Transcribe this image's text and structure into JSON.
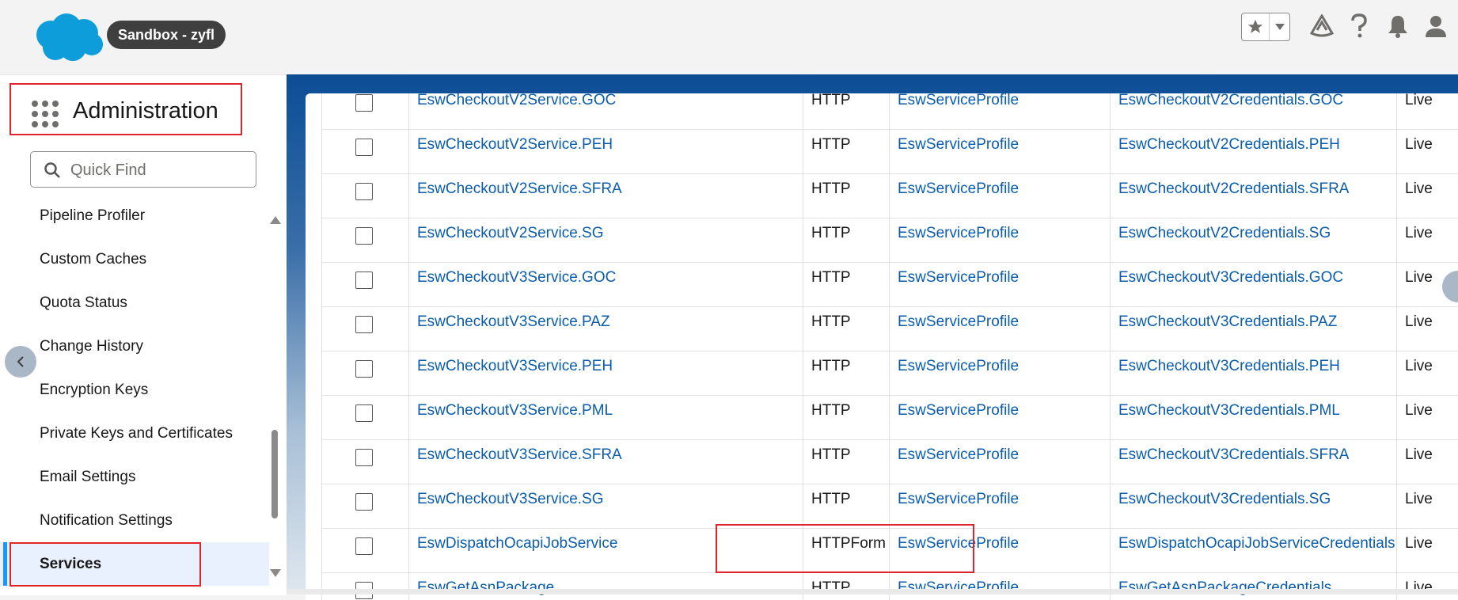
{
  "header": {
    "sandbox_badge": "Sandbox - zyfl",
    "icons": [
      "salesforce-cloud-logo",
      "star-icon",
      "chevron-down-icon",
      "trailhead-icon",
      "help-icon",
      "bell-icon",
      "user-avatar-icon"
    ]
  },
  "sidebar": {
    "app_title": "Administration",
    "quick_find_placeholder": "Quick Find",
    "items": [
      {
        "label": "Pipeline Profiler"
      },
      {
        "label": "Custom Caches"
      },
      {
        "label": "Quota Status"
      },
      {
        "label": "Change History"
      },
      {
        "label": "Encryption Keys"
      },
      {
        "label": "Private Keys and Certificates"
      },
      {
        "label": "Email Settings"
      },
      {
        "label": "Notification Settings"
      },
      {
        "label": "Services",
        "active": true
      }
    ]
  },
  "table": {
    "rows": [
      {
        "name": "EswCheckoutV2Service.GOC",
        "type": "HTTP",
        "profile": "EswServiceProfile",
        "credential": "EswCheckoutV2Credentials.GOC",
        "status": "Live"
      },
      {
        "name": "EswCheckoutV2Service.PEH",
        "type": "HTTP",
        "profile": "EswServiceProfile",
        "credential": "EswCheckoutV2Credentials.PEH",
        "status": "Live"
      },
      {
        "name": "EswCheckoutV2Service.SFRA",
        "type": "HTTP",
        "profile": "EswServiceProfile",
        "credential": "EswCheckoutV2Credentials.SFRA",
        "status": "Live"
      },
      {
        "name": "EswCheckoutV2Service.SG",
        "type": "HTTP",
        "profile": "EswServiceProfile",
        "credential": "EswCheckoutV2Credentials.SG",
        "status": "Live"
      },
      {
        "name": "EswCheckoutV3Service.GOC",
        "type": "HTTP",
        "profile": "EswServiceProfile",
        "credential": "EswCheckoutV3Credentials.GOC",
        "status": "Live"
      },
      {
        "name": "EswCheckoutV3Service.PAZ",
        "type": "HTTP",
        "profile": "EswServiceProfile",
        "credential": "EswCheckoutV3Credentials.PAZ",
        "status": "Live"
      },
      {
        "name": "EswCheckoutV3Service.PEH",
        "type": "HTTP",
        "profile": "EswServiceProfile",
        "credential": "EswCheckoutV3Credentials.PEH",
        "status": "Live"
      },
      {
        "name": "EswCheckoutV3Service.PML",
        "type": "HTTP",
        "profile": "EswServiceProfile",
        "credential": "EswCheckoutV3Credentials.PML",
        "status": "Live"
      },
      {
        "name": "EswCheckoutV3Service.SFRA",
        "type": "HTTP",
        "profile": "EswServiceProfile",
        "credential": "EswCheckoutV3Credentials.SFRA",
        "status": "Live",
        "highlighted": true
      },
      {
        "name": "EswCheckoutV3Service.SG",
        "type": "HTTP",
        "profile": "EswServiceProfile",
        "credential": "EswCheckoutV3Credentials.SG",
        "status": "Live"
      },
      {
        "name": "EswDispatchOcapiJobService",
        "type": "HTTPForm",
        "profile": "EswServiceProfile",
        "credential": "EswDispatchOcapiJobServiceCredentials",
        "status": "Live"
      },
      {
        "name": "EswGetAsnPackage",
        "type": "HTTP",
        "profile": "EswServiceProfile",
        "credential": "EswGetAsnPackageCredentials",
        "status": "Live"
      }
    ]
  },
  "colors": {
    "link": "#0b5cab",
    "highlight_box": "#e0242b",
    "brand_blue": "#0b4d96",
    "salesforce_cloud": "#00a1e0"
  }
}
